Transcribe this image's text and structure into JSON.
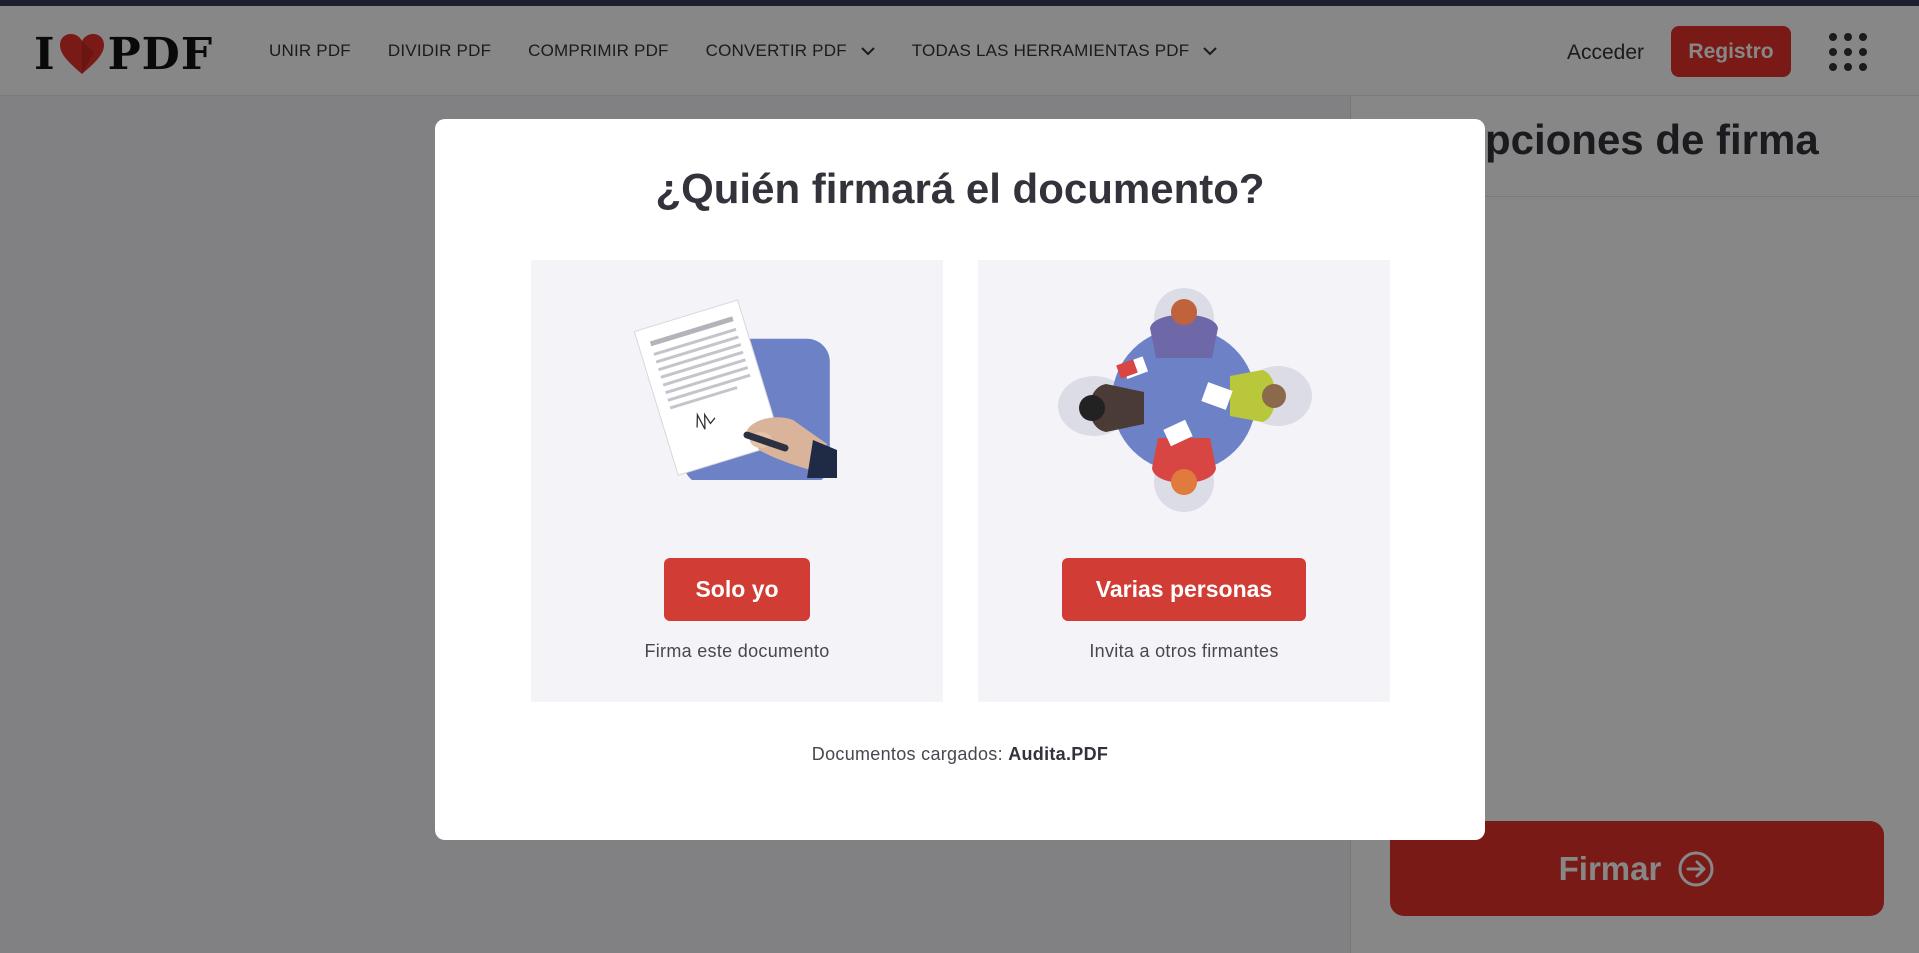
{
  "header": {
    "logo_left": "I",
    "logo_right": "PDF",
    "nav": [
      {
        "label": "UNIR PDF"
      },
      {
        "label": "DIVIDIR PDF"
      },
      {
        "label": "COMPRIMIR PDF"
      },
      {
        "label": "CONVERTIR PDF"
      },
      {
        "label": "TODAS LAS HERRAMIENTAS PDF"
      }
    ],
    "login_label": "Acceder",
    "register_label": "Registro"
  },
  "sidebar": {
    "title": "Opciones de firma",
    "sign_button_label": "Firmar"
  },
  "modal": {
    "title": "¿Quién firmará el documento?",
    "options": [
      {
        "button_label": "Solo yo",
        "description": "Firma este documento",
        "icon": "sign-document-illustration"
      },
      {
        "button_label": "Varias personas",
        "description": "Invita a otros firmantes",
        "icon": "team-meeting-illustration"
      }
    ],
    "loaded_label": "Documentos cargados:",
    "loaded_file": "Audita.PDF"
  },
  "colors": {
    "brand_red": "#e5322d",
    "button_red": "#d13c34",
    "text_dark": "#33333b",
    "option_bg": "#f4f4f8",
    "accent_blue": "#6d82c6"
  }
}
